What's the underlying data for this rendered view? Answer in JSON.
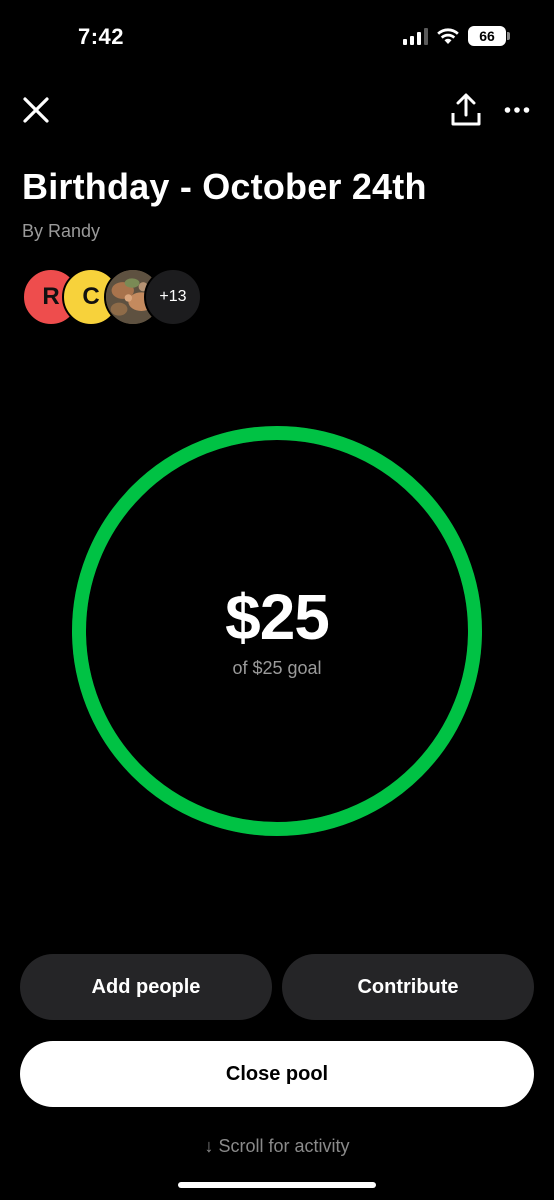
{
  "status_bar": {
    "time": "7:42",
    "battery": "66",
    "icons": [
      "cellular-signal-icon",
      "wifi-icon",
      "battery-icon"
    ]
  },
  "toolbar": {
    "icons": [
      "close-icon",
      "share-icon",
      "more-icon"
    ]
  },
  "pool": {
    "title": "Birthday - October 24th",
    "byline": "By Randy",
    "avatars": [
      {
        "initial": "R",
        "color": "#ee4d4d"
      },
      {
        "initial": "C",
        "color": "#f7d23b"
      },
      {
        "initial": "",
        "type": "photo"
      }
    ],
    "more_count": "+13"
  },
  "progress": {
    "amount": "$25",
    "goal_text": "of $25 goal",
    "fraction": 1.0,
    "ring_color": "#00c244"
  },
  "actions": {
    "add_people": "Add people",
    "contribute": "Contribute",
    "close_pool": "Close pool"
  },
  "footer": {
    "scroll_arrow": "↓",
    "scroll_hint": "Scroll for activity"
  }
}
